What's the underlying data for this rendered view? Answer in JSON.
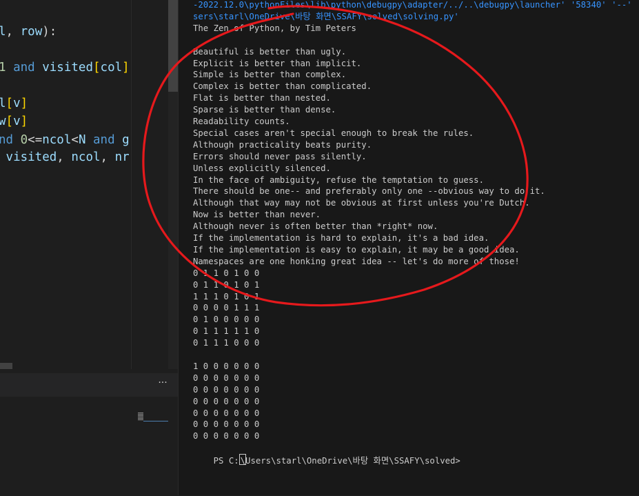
{
  "editor": {
    "lines": [
      [
        {
          "t": "l",
          "c": "vr"
        },
        {
          "t": ", ",
          "c": "pn"
        },
        {
          "t": "row",
          "c": "vr"
        },
        {
          "t": "):",
          "c": "pn"
        }
      ],
      [
        {
          "t": "1 ",
          "c": "nm"
        },
        {
          "t": "and ",
          "c": "kw"
        },
        {
          "t": "visited",
          "c": "vr"
        },
        {
          "t": "[",
          "c": "br"
        },
        {
          "t": "col",
          "c": "vr"
        },
        {
          "t": "]",
          "c": "br"
        }
      ],
      [
        {
          "t": "l",
          "c": "vr"
        },
        {
          "t": "[",
          "c": "br"
        },
        {
          "t": "v",
          "c": "vr"
        },
        {
          "t": "]",
          "c": "br"
        }
      ],
      [
        {
          "t": "w",
          "c": "vr"
        },
        {
          "t": "[",
          "c": "br"
        },
        {
          "t": "v",
          "c": "vr"
        },
        {
          "t": "]",
          "c": "br"
        }
      ],
      [
        {
          "t": "nd ",
          "c": "kw"
        },
        {
          "t": "0",
          "c": "nm"
        },
        {
          "t": "<=",
          "c": "pn"
        },
        {
          "t": "ncol",
          "c": "vr"
        },
        {
          "t": "<",
          "c": "pn"
        },
        {
          "t": "N ",
          "c": "vr"
        },
        {
          "t": "and ",
          "c": "kw"
        },
        {
          "t": "g",
          "c": "vr"
        }
      ],
      [
        {
          "t": " visited",
          "c": "vr"
        },
        {
          "t": ", ",
          "c": "pn"
        },
        {
          "t": "ncol",
          "c": "vr"
        },
        {
          "t": ", ",
          "c": "pn"
        },
        {
          "t": "nr",
          "c": "vr"
        }
      ]
    ]
  },
  "panel": {
    "more_label": "···"
  },
  "terminal": {
    "lines": [
      {
        "text": "-2022.12.0\\pythonFiles\\lib\\python\\debugpy\\adapter/../..\\debugpy\\launcher' '58340' '--' 'c:\\U",
        "color": "blue"
      },
      {
        "text": "sers\\starl\\OneDrive\\바탕 화면\\SSAFY\\solved\\solving.py'",
        "color": "blue"
      },
      {
        "text": "The Zen of Python, by Tim Peters"
      },
      {
        "text": ""
      },
      {
        "text": "Beautiful is better than ugly."
      },
      {
        "text": "Explicit is better than implicit."
      },
      {
        "text": "Simple is better than complex."
      },
      {
        "text": "Complex is better than complicated."
      },
      {
        "text": "Flat is better than nested."
      },
      {
        "text": "Sparse is better than dense."
      },
      {
        "text": "Readability counts."
      },
      {
        "text": "Special cases aren't special enough to break the rules."
      },
      {
        "text": "Although practicality beats purity."
      },
      {
        "text": "Errors should never pass silently."
      },
      {
        "text": "Unless explicitly silenced."
      },
      {
        "text": "In the face of ambiguity, refuse the temptation to guess."
      },
      {
        "text": "There should be one-- and preferably only one --obvious way to do it."
      },
      {
        "text": "Although that way may not be obvious at first unless you're Dutch."
      },
      {
        "text": "Now is better than never."
      },
      {
        "text": "Although never is often better than *right* now."
      },
      {
        "text": "If the implementation is hard to explain, it's a bad idea."
      },
      {
        "text": "If the implementation is easy to explain, it may be a good idea."
      },
      {
        "text": "Namespaces are one honking great idea -- let's do more of those!"
      },
      {
        "text": "0 1 1 0 1 0 0"
      },
      {
        "text": "0 1 1 0 1 0 1"
      },
      {
        "text": "1 1 1 0 1 0 1"
      },
      {
        "text": "0 0 0 0 1 1 1"
      },
      {
        "text": "0 1 0 0 0 0 0"
      },
      {
        "text": "0 1 1 1 1 1 0"
      },
      {
        "text": "0 1 1 1 0 0 0"
      },
      {
        "text": ""
      },
      {
        "text": "1 0 0 0 0 0 0"
      },
      {
        "text": "0 0 0 0 0 0 0"
      },
      {
        "text": "0 0 0 0 0 0 0"
      },
      {
        "text": "0 0 0 0 0 0 0"
      },
      {
        "text": "0 0 0 0 0 0 0"
      },
      {
        "text": "0 0 0 0 0 0 0"
      },
      {
        "text": "0 0 0 0 0 0 0"
      }
    ],
    "prompt_before_cursor": "PS C:",
    "prompt_after_cursor": "\\Users\\starl\\OneDrive\\바탕 화면\\SSAFY\\solved>"
  },
  "annotation": {
    "color": "#e5191c"
  }
}
